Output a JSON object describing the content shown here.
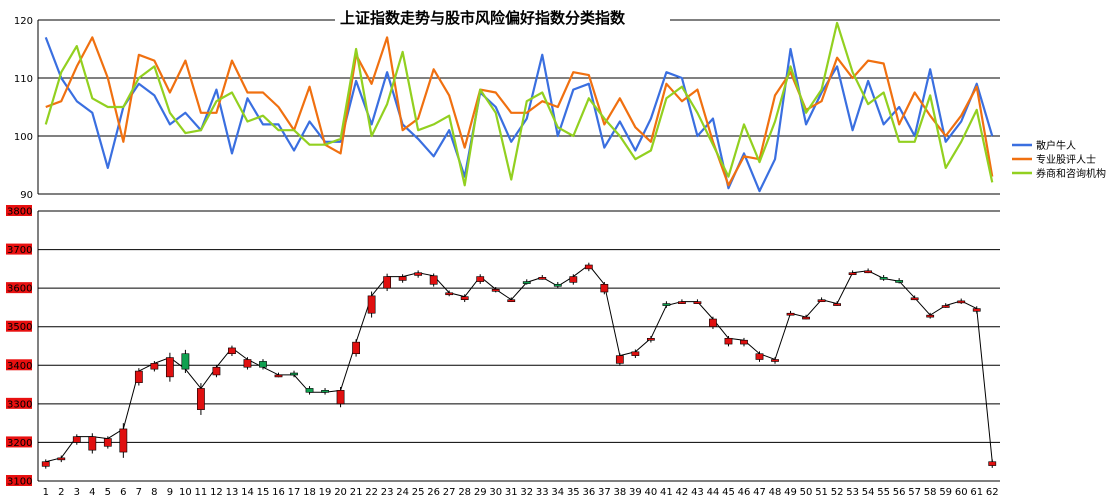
{
  "chart_data": [
    {
      "type": "line",
      "title": "上证指数走势与股市风险偏好指数分类指数",
      "xlabel": "",
      "ylabel": "",
      "ylim": [
        90,
        120
      ],
      "yticks": [
        "90",
        "100",
        "110",
        "120"
      ],
      "grid": true,
      "legend_position": "right",
      "colors": {
        "散户牛人": "#3a6fe0",
        "专业股评人士": "#f07010",
        "券商和咨询机构": "#92d020"
      },
      "series": [
        {
          "name": "散户牛人",
          "values": [
            117,
            110,
            106,
            104,
            94.5,
            105,
            109,
            107,
            102,
            104,
            101,
            108,
            97,
            106.5,
            102,
            102,
            97.5,
            102.5,
            99,
            99,
            109.5,
            102,
            111,
            102,
            99.5,
            96.5,
            101,
            93,
            107.5,
            105,
            99,
            103,
            114,
            100,
            108,
            109,
            98,
            102.5,
            97.5,
            103,
            111,
            110,
            100,
            103,
            91,
            97,
            90.5,
            96,
            115,
            102,
            107.5,
            112,
            101,
            109.5,
            102,
            105,
            100,
            111.5,
            99,
            102.5,
            109,
            100
          ]
        },
        {
          "name": "专业股评人士",
          "values": [
            105,
            106,
            112,
            117,
            110,
            99,
            114,
            113,
            107.5,
            113,
            104,
            104,
            113,
            107.5,
            107.5,
            105,
            101,
            108.5,
            98.5,
            97,
            114,
            109,
            117,
            101,
            103,
            111.5,
            107,
            98,
            108,
            107.5,
            104,
            104,
            106,
            105,
            111,
            110.5,
            102,
            106.5,
            101.5,
            99,
            109,
            106,
            108,
            99,
            91.5,
            96.5,
            96,
            107,
            111,
            104.5,
            106,
            113.5,
            110,
            113,
            112.5,
            102,
            107.5,
            103.5,
            100,
            103.5,
            108.5,
            93
          ]
        },
        {
          "name": "券商和咨询机构",
          "values": [
            102,
            111,
            115.5,
            106.5,
            105,
            105,
            110,
            112,
            104,
            100.5,
            101,
            106,
            107.5,
            102.5,
            103.5,
            101,
            101,
            98.5,
            98.5,
            99.5,
            115,
            100,
            105.5,
            114.5,
            101,
            102,
            103.5,
            91.5,
            108,
            104,
            92.5,
            106,
            107.5,
            101.5,
            100,
            106.5,
            103,
            100,
            96,
            97.5,
            106.5,
            108.5,
            104,
            98.5,
            93,
            102,
            95.5,
            102.5,
            112,
            104,
            108,
            119.5,
            111,
            105.5,
            107.5,
            99,
            99,
            107,
            94.5,
            99,
            104.5,
            92
          ]
        }
      ]
    },
    {
      "type": "candlestick",
      "title": "",
      "xlabel": "",
      "ylabel": "",
      "ylim": [
        3100,
        3800
      ],
      "grid": true,
      "yticks": [
        "3100",
        "3200",
        "3300",
        "3400",
        "3500",
        "3600",
        "3700",
        "3800"
      ],
      "x": [
        "1",
        "2",
        "3",
        "4",
        "5",
        "6",
        "7",
        "8",
        "9",
        "10",
        "11",
        "12",
        "13",
        "14",
        "15",
        "16",
        "17",
        "18",
        "19",
        "20",
        "21",
        "22",
        "23",
        "24",
        "25",
        "26",
        "27",
        "28",
        "29",
        "30",
        "31",
        "32",
        "33",
        "34",
        "35",
        "36",
        "37",
        "38",
        "39",
        "40",
        "41",
        "42",
        "43",
        "44",
        "45",
        "46",
        "47",
        "48",
        "49",
        "50",
        "51",
        "52",
        "53",
        "54",
        "55",
        "56",
        "57",
        "58",
        "59",
        "60",
        "61",
        "62"
      ],
      "colors": {
        "up": "#e01010",
        "down": "#10a050"
      },
      "series": [
        {
          "open": [
            3138,
            3155,
            3200,
            3180,
            3190,
            3175,
            3355,
            3390,
            3370,
            3430,
            3285,
            3375,
            3430,
            3395,
            3410,
            3375,
            3380,
            3340,
            3335,
            3300,
            3430,
            3535,
            3600,
            3620,
            3633,
            3610,
            3585,
            3570,
            3617,
            3595,
            3570,
            3617,
            3628,
            3610,
            3615,
            3650,
            3590,
            3405,
            3425,
            3465,
            3560,
            3565,
            3565,
            3500,
            3455,
            3455,
            3415,
            3410,
            3535,
            3525,
            3570,
            3560,
            3640,
            3645,
            3628,
            3620,
            3575,
            3527,
            3555,
            3565,
            3540,
            3140
          ],
          "close": [
            3150,
            3160,
            3215,
            3215,
            3210,
            3235,
            3385,
            3405,
            3420,
            3390,
            3340,
            3395,
            3445,
            3415,
            3395,
            3375,
            3375,
            3330,
            3330,
            3335,
            3460,
            3580,
            3630,
            3630,
            3640,
            3632,
            3588,
            3578,
            3630,
            3597,
            3570,
            3615,
            3628,
            3605,
            3630,
            3660,
            3610,
            3425,
            3435,
            3470,
            3555,
            3565,
            3565,
            3520,
            3470,
            3465,
            3430,
            3415,
            3535,
            3525,
            3570,
            3560,
            3640,
            3645,
            3625,
            3618,
            3575,
            3530,
            3555,
            3567,
            3547,
            3150
          ]
        }
      ]
    }
  ]
}
